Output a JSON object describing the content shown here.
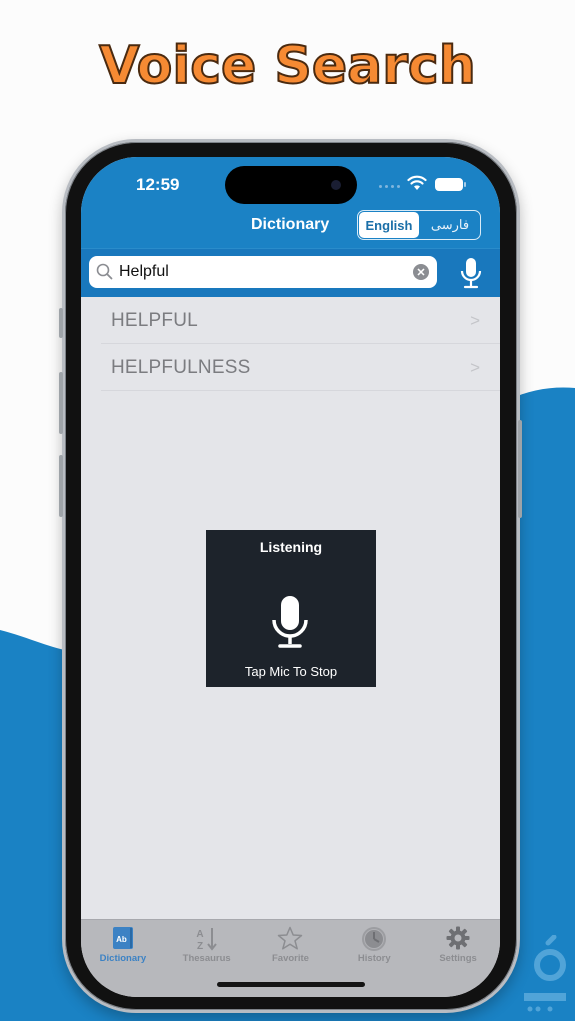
{
  "promo": {
    "headline": "Voice Search"
  },
  "status_bar": {
    "time": "12:59"
  },
  "nav": {
    "title": "Dictionary",
    "language_segment": [
      {
        "label": "English",
        "selected": true
      },
      {
        "label": "فارسی",
        "selected": false
      }
    ]
  },
  "search": {
    "value": "Helpful",
    "placeholder": "",
    "clear_icon": "clear-circle-icon",
    "voice_icon": "microphone-icon"
  },
  "results": [
    {
      "word": "HELPFUL"
    },
    {
      "word": "HELPFULNESS"
    }
  ],
  "listening_overlay": {
    "title": "Listening",
    "icon": "microphone-icon",
    "hint": "Tap Mic To Stop"
  },
  "tabbar": {
    "tabs": [
      {
        "label": "Dictionary",
        "icon": "dictionary-book-icon",
        "active": true
      },
      {
        "label": "Thesaurus",
        "icon": "sort-az-icon",
        "active": false
      },
      {
        "label": "Favorite",
        "icon": "star-icon",
        "active": false
      },
      {
        "label": "History",
        "icon": "clock-icon",
        "active": false
      },
      {
        "label": "Settings",
        "icon": "gear-icon",
        "active": false
      }
    ]
  },
  "colors": {
    "accent_blue": "#1b82c5",
    "headline_orange": "#f68a33",
    "hud_background": "#1d232b",
    "active_tab": "#3c82c4"
  }
}
